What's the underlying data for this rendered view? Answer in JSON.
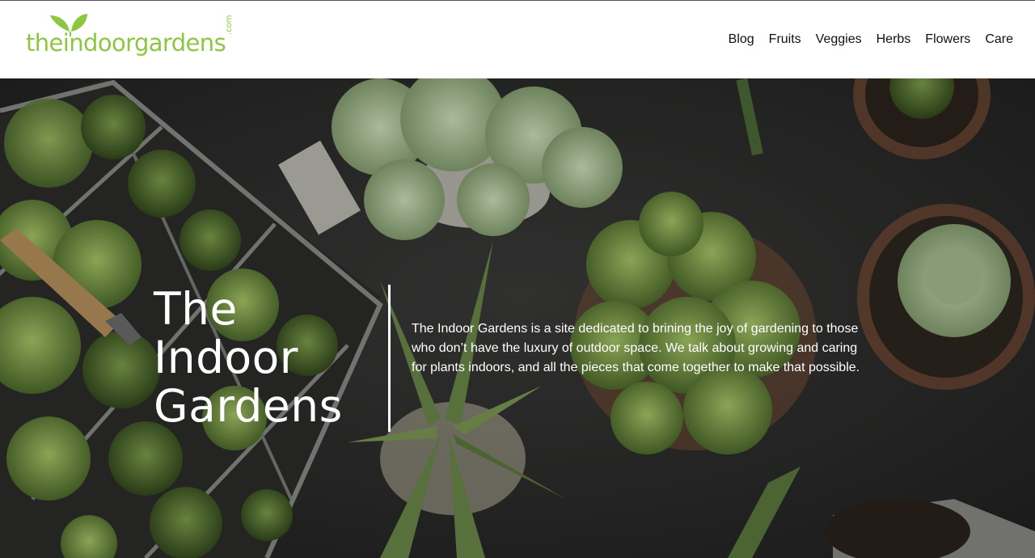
{
  "header": {
    "logo": {
      "word_the": "the",
      "word_rest": "indoorgardens",
      "suffix": ".com",
      "leaf_icon": "leaf-icon"
    },
    "nav": [
      {
        "label": "Blog"
      },
      {
        "label": "Fruits"
      },
      {
        "label": "Veggies"
      },
      {
        "label": "Herbs"
      },
      {
        "label": "Flowers"
      },
      {
        "label": "Care"
      }
    ]
  },
  "hero": {
    "title_line1": "The",
    "title_line2": "Indoor",
    "title_line3": "Gardens",
    "description": "The Indoor Gardens is a site dedicated to brining the joy of gardening to those who don’t have the luxury of outdoor space. We talk about growing and caring for plants indoors, and all the pieces that come together to make that possible."
  },
  "colors": {
    "brand_green": "#8dc63f",
    "nav_text": "#111111",
    "hero_background": "#2a2b2a",
    "hero_text": "#ffffff"
  }
}
